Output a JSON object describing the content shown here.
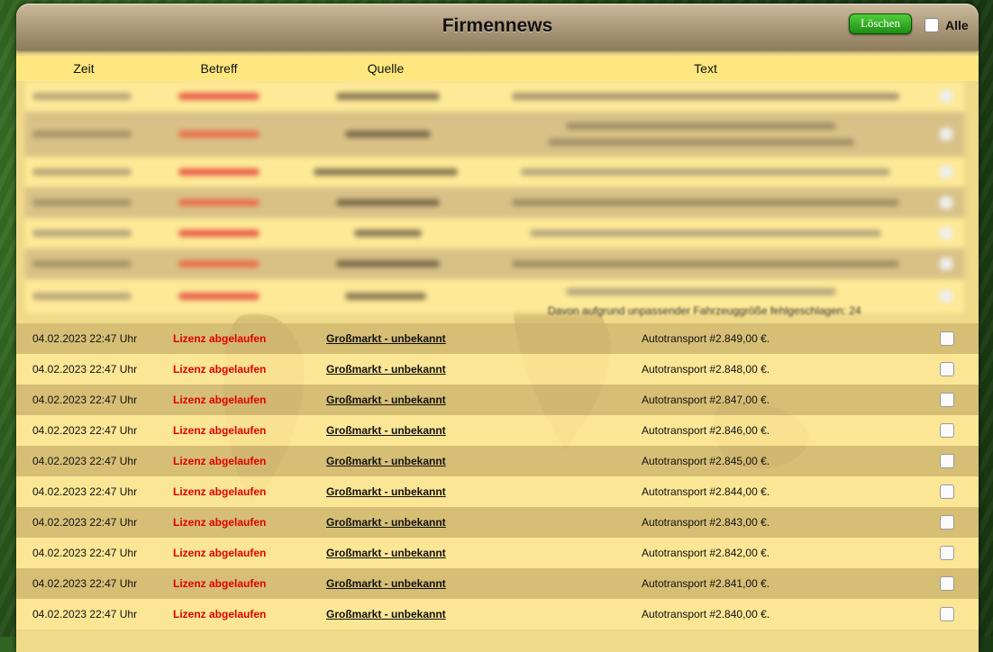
{
  "window": {
    "title": "Firmennews"
  },
  "toolbar": {
    "delete_label": "Löschen",
    "all_label": "Alle"
  },
  "table": {
    "columns": [
      "Zeit",
      "Betreff",
      "Quelle",
      "Text"
    ],
    "partial_text": "Davon aufgrund unpassender Fahrzeuggröße fehlgeschlagen: 24",
    "rows": [
      {
        "time": "04.02.2023 22:47 Uhr",
        "subject": "Lizenz abgelaufen",
        "source": "Großmarkt - unbekannt",
        "text": "Autotransport #2.849,00 €."
      },
      {
        "time": "04.02.2023 22:47 Uhr",
        "subject": "Lizenz abgelaufen",
        "source": "Großmarkt - unbekannt",
        "text": "Autotransport #2.848,00 €."
      },
      {
        "time": "04.02.2023 22:47 Uhr",
        "subject": "Lizenz abgelaufen",
        "source": "Großmarkt - unbekannt",
        "text": "Autotransport #2.847,00 €."
      },
      {
        "time": "04.02.2023 22:47 Uhr",
        "subject": "Lizenz abgelaufen",
        "source": "Großmarkt - unbekannt",
        "text": "Autotransport #2.846,00 €."
      },
      {
        "time": "04.02.2023 22:47 Uhr",
        "subject": "Lizenz abgelaufen",
        "source": "Großmarkt - unbekannt",
        "text": "Autotransport #2.845,00 €."
      },
      {
        "time": "04.02.2023 22:47 Uhr",
        "subject": "Lizenz abgelaufen",
        "source": "Großmarkt - unbekannt",
        "text": "Autotransport #2.844,00 €."
      },
      {
        "time": "04.02.2023 22:47 Uhr",
        "subject": "Lizenz abgelaufen",
        "source": "Großmarkt - unbekannt",
        "text": "Autotransport #2.843,00 €."
      },
      {
        "time": "04.02.2023 22:47 Uhr",
        "subject": "Lizenz abgelaufen",
        "source": "Großmarkt - unbekannt",
        "text": "Autotransport #2.842,00 €."
      },
      {
        "time": "04.02.2023 22:47 Uhr",
        "subject": "Lizenz abgelaufen",
        "source": "Großmarkt - unbekannt",
        "text": "Autotransport #2.841,00 €."
      },
      {
        "time": "04.02.2023 22:47 Uhr",
        "subject": "Lizenz abgelaufen",
        "source": "Großmarkt - unbekannt",
        "text": "Autotransport #2.840,00 €."
      }
    ]
  },
  "colors": {
    "subject_red": "#e00000",
    "button_green": "#1e8d16",
    "header_yellow": "#fde77e"
  }
}
